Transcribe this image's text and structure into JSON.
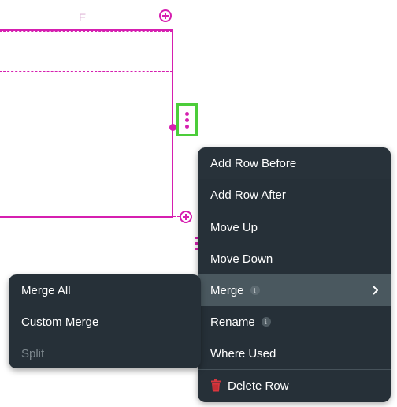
{
  "grid": {
    "column_label": "E",
    "accent_color": "#d61fb0",
    "handle_highlight_color": "#4ccd3a"
  },
  "icons": {
    "add_column": "plus-circle-icon",
    "add_row": "plus-circle-icon",
    "row_options": "more-vertical-icon"
  },
  "context_menu": {
    "items": [
      {
        "label": "Add Row Before"
      },
      {
        "label": "Add Row After"
      },
      {
        "label": "Move Up"
      },
      {
        "label": "Move Down"
      },
      {
        "label": "Merge",
        "info": "i",
        "has_submenu": true,
        "active": true
      },
      {
        "label": "Rename",
        "info": "i"
      },
      {
        "label": "Where Used"
      },
      {
        "label": "Delete Row",
        "icon": "trash-icon",
        "icon_color": "#d9363e"
      }
    ]
  },
  "merge_submenu": {
    "items": [
      {
        "label": "Merge All",
        "disabled": false
      },
      {
        "label": "Custom Merge",
        "disabled": false
      },
      {
        "label": "Split",
        "disabled": true
      }
    ]
  }
}
